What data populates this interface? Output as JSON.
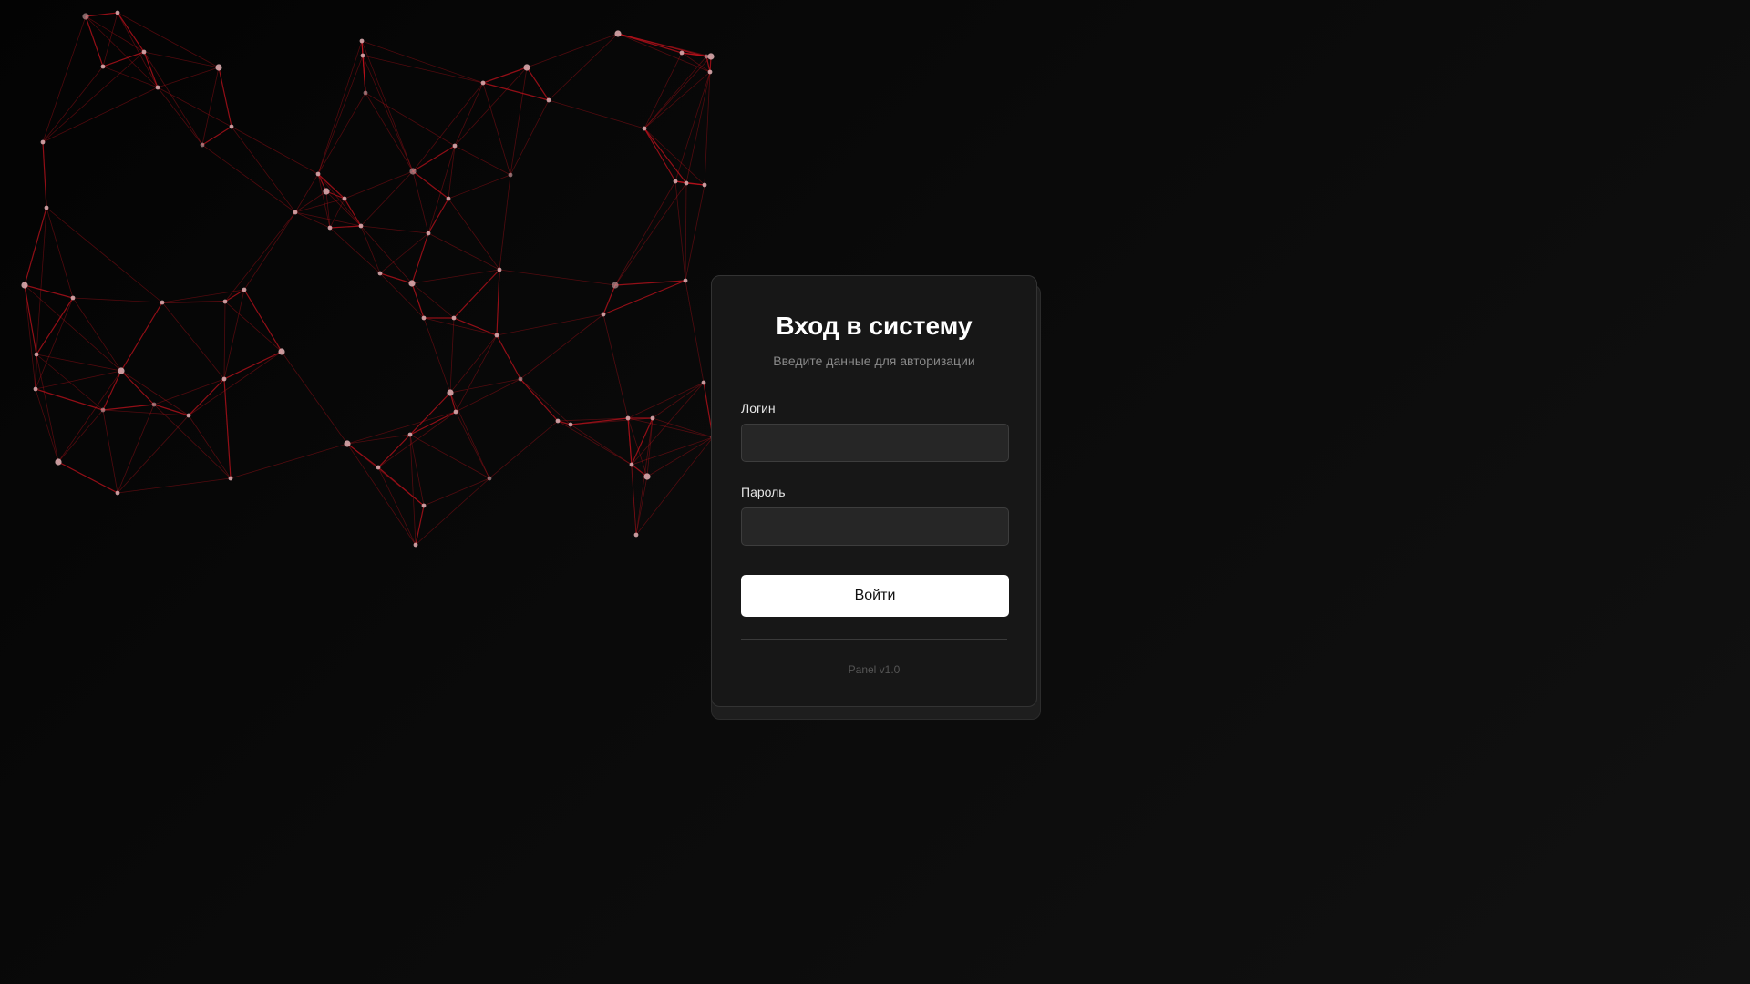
{
  "background": {
    "accent": "#c0121c",
    "node_color": "#d8a8ac"
  },
  "login": {
    "title": "Вход в систему",
    "subtitle": "Введите данные для авторизации",
    "username_label": "Логин",
    "username_value": "",
    "password_label": "Пароль",
    "password_value": "",
    "submit_label": "Войти",
    "version": "Panel v1.0"
  }
}
